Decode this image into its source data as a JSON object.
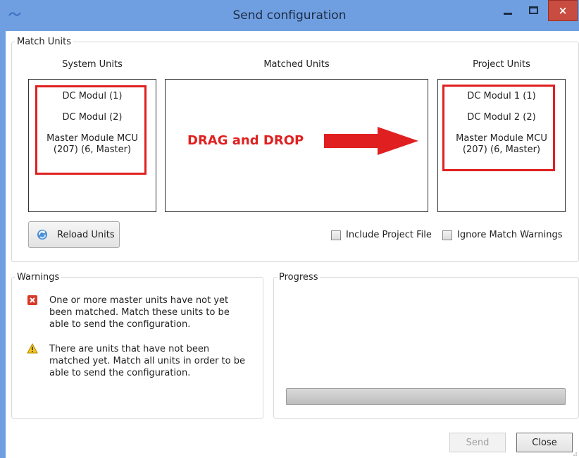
{
  "window": {
    "title": "Send configuration",
    "icon": "app-logo-icon",
    "controls": [
      "minimize-icon",
      "maximize-icon",
      "close-icon"
    ],
    "close_glyph": "×",
    "accent_color": "#6f9fe0",
    "close_color": "#c94c40"
  },
  "match_units": {
    "legend": "Match Units",
    "system_units": {
      "header": "System Units",
      "items": [
        "DC Modul (1)",
        "DC Modul (2)",
        "Master Module MCU (207) (6, Master)"
      ]
    },
    "matched_units": {
      "header": "Matched Units",
      "annotation": "DRAG and DROP",
      "annotation_color": "#e02020"
    },
    "project_units": {
      "header": "Project Units",
      "items": [
        "DC Modul 1 (1)",
        "DC Modul 2 (2)",
        "Master Module MCU (207) (6, Master)"
      ]
    },
    "reload_button": "Reload Units",
    "include_project_file": {
      "label": "Include Project File",
      "checked": false
    },
    "ignore_match_warnings": {
      "label": "Ignore Match Warnings",
      "checked": false
    }
  },
  "warnings": {
    "legend": "Warnings",
    "items": [
      {
        "type": "error",
        "icon": "error-icon",
        "text": "One or more master units have not yet been matched. Match these units to be able to send the configuration."
      },
      {
        "type": "warning",
        "icon": "warning-icon",
        "text": "There are units that have not been matched yet. Match all units in order to be able to send the configuration."
      }
    ]
  },
  "progress": {
    "legend": "Progress",
    "value": 0
  },
  "footer": {
    "send_label": "Send",
    "send_enabled": false,
    "close_label": "Close"
  }
}
